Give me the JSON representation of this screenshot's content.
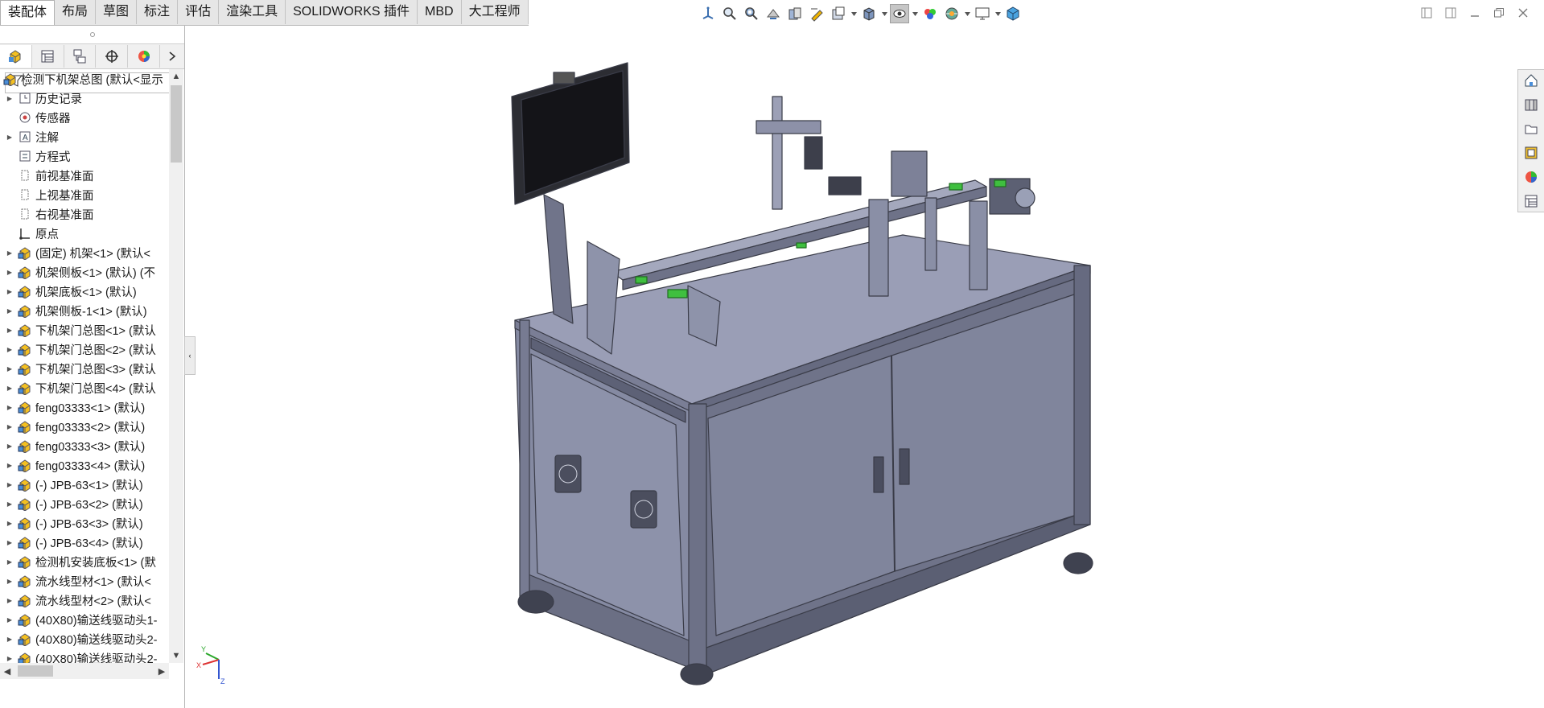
{
  "tabs": [
    "装配体",
    "布局",
    "草图",
    "标注",
    "评估",
    "渲染工具",
    "SOLIDWORKS 插件",
    "MBD",
    "大工程师"
  ],
  "active_tab": "装配体",
  "hud_icons": [
    "view-orientation-icon",
    "zoom-to-fit-icon",
    "zoom-to-area-icon",
    "previous-view-icon",
    "section-view-icon",
    "dynamic-annotation-icon",
    "view-settings-icon",
    "display-style-icon",
    "hide-show-items-icon",
    "edit-appearance-icon",
    "apply-scene-icon",
    "view-setting-monitor-icon",
    "realview-icon"
  ],
  "panel_tabs": [
    "feature-manager-icon",
    "property-manager-icon",
    "configuration-manager-icon",
    "dimxpert-icon",
    "display-manager-icon"
  ],
  "tree": {
    "root": "检测下机架总图  (默认<显示",
    "items": [
      {
        "label": "历史记录",
        "icon": "history-icon",
        "expandable": true
      },
      {
        "label": "传感器",
        "icon": "sensor-icon",
        "expandable": false
      },
      {
        "label": "注解",
        "icon": "annotation-icon",
        "expandable": true
      },
      {
        "label": "方程式",
        "icon": "equation-icon",
        "expandable": false
      },
      {
        "label": "前视基准面",
        "icon": "plane-icon",
        "expandable": false
      },
      {
        "label": "上视基准面",
        "icon": "plane-icon",
        "expandable": false
      },
      {
        "label": "右视基准面",
        "icon": "plane-icon",
        "expandable": false
      },
      {
        "label": "原点",
        "icon": "origin-icon",
        "expandable": false
      },
      {
        "label": "(固定) 机架<1> (默认<",
        "icon": "subassembly-icon",
        "expandable": true
      },
      {
        "label": "机架侧板<1> (默认) (不",
        "icon": "subassembly-icon",
        "expandable": true
      },
      {
        "label": "机架底板<1> (默认)",
        "icon": "subassembly-icon",
        "expandable": true
      },
      {
        "label": "机架侧板-1<1> (默认)",
        "icon": "subassembly-icon",
        "expandable": true
      },
      {
        "label": "下机架门总图<1> (默认",
        "icon": "subassembly-icon",
        "expandable": true
      },
      {
        "label": "下机架门总图<2> (默认",
        "icon": "subassembly-icon",
        "expandable": true
      },
      {
        "label": "下机架门总图<3> (默认",
        "icon": "subassembly-icon",
        "expandable": true
      },
      {
        "label": "下机架门总图<4> (默认",
        "icon": "subassembly-icon",
        "expandable": true
      },
      {
        "label": "feng03333<1> (默认)",
        "icon": "subassembly-icon",
        "expandable": true
      },
      {
        "label": "feng03333<2> (默认)",
        "icon": "subassembly-icon",
        "expandable": true
      },
      {
        "label": "feng03333<3> (默认)",
        "icon": "subassembly-icon",
        "expandable": true
      },
      {
        "label": "feng03333<4> (默认)",
        "icon": "subassembly-icon",
        "expandable": true
      },
      {
        "label": "(-) JPB-63<1> (默认)",
        "icon": "subassembly-icon",
        "expandable": true
      },
      {
        "label": "(-) JPB-63<2> (默认)",
        "icon": "subassembly-icon",
        "expandable": true
      },
      {
        "label": "(-) JPB-63<3> (默认)",
        "icon": "subassembly-icon",
        "expandable": true
      },
      {
        "label": "(-) JPB-63<4> (默认)",
        "icon": "subassembly-icon",
        "expandable": true
      },
      {
        "label": "检测机安装底板<1> (默",
        "icon": "subassembly-icon",
        "expandable": true
      },
      {
        "label": "流水线型材<1> (默认<",
        "icon": "subassembly-icon",
        "expandable": true
      },
      {
        "label": "流水线型材<2> (默认<",
        "icon": "subassembly-icon",
        "expandable": true
      },
      {
        "label": "(40X80)输送线驱动头1-",
        "icon": "subassembly-icon",
        "expandable": true
      },
      {
        "label": "(40X80)输送线驱动头2-",
        "icon": "subassembly-icon",
        "expandable": true
      },
      {
        "label": "(40X80)输送线驱动头2-",
        "icon": "subassembly-icon",
        "expandable": true
      }
    ]
  },
  "taskpane_icons": [
    "solidworks-resources-icon",
    "design-library-icon",
    "file-explorer-icon",
    "view-palette-icon",
    "appearances-icon",
    "custom-properties-icon"
  ],
  "triad": {
    "x": "X",
    "y": "Y",
    "z": "Z"
  },
  "colors": {
    "model_body": "#8a8ea6",
    "model_dark": "#6f7389",
    "model_edge": "#3a3c48",
    "accent_green": "#3fbf3f"
  }
}
